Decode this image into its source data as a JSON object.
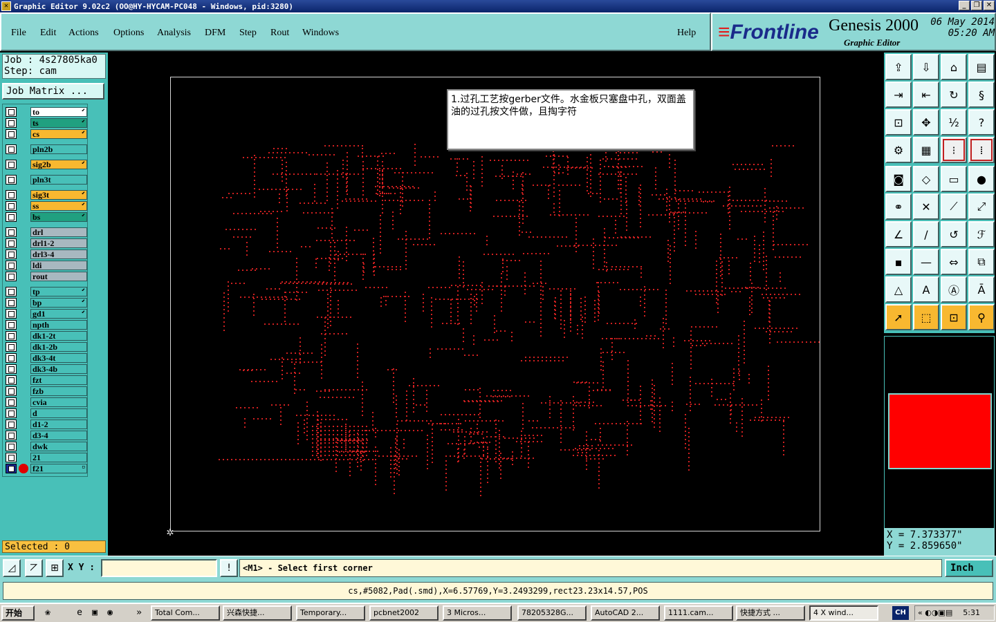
{
  "window": {
    "title": "Graphic Editor 9.02c2  (OO@HY-HYCAM-PC048 - Windows, pid:3280)",
    "controls": [
      "_",
      "❐",
      "✕"
    ]
  },
  "menu": {
    "items": [
      "File",
      "Edit",
      "Actions",
      "Options",
      "Analysis",
      "DFM",
      "Step",
      "Rout",
      "Windows"
    ],
    "help": "Help"
  },
  "brand": {
    "logo": "Frontline",
    "product": "Genesis 2000",
    "subtitle": "Graphic Editor",
    "date": "06 May 2014",
    "time": "05:20 AM"
  },
  "job": {
    "job_line": "Job : 4s27805ka0",
    "step_line": "Step: cam",
    "matrix_button": "Job Matrix ..."
  },
  "layers": [
    {
      "name": "to",
      "color": "#ffffff",
      "mark": "⬋"
    },
    {
      "name": "ts",
      "color": "#20a080",
      "mark": "⬋"
    },
    {
      "name": "cs",
      "color": "#f8b830",
      "mark": "⬋"
    },
    {
      "name": "pln2b",
      "color": "#48c0b8",
      "mark": ""
    },
    {
      "name": "sig2b",
      "color": "#f8b830",
      "mark": "⬋"
    },
    {
      "name": "pln3t",
      "color": "#48c0b8",
      "mark": ""
    },
    {
      "name": "sig3t",
      "color": "#f8b830",
      "mark": "⬋"
    },
    {
      "name": "ss",
      "color": "#f8b830",
      "mark": "⬋"
    },
    {
      "name": "bs",
      "color": "#20a080",
      "mark": "⬋"
    },
    {
      "name": "drl",
      "color": "#a8b8c0",
      "mark": ""
    },
    {
      "name": "drl1-2",
      "color": "#a8b8c0",
      "mark": ""
    },
    {
      "name": "drl3-4",
      "color": "#a8b8c0",
      "mark": ""
    },
    {
      "name": "ldi",
      "color": "#a8b8c0",
      "mark": ""
    },
    {
      "name": "rout",
      "color": "#a8b8c0",
      "mark": ""
    },
    {
      "name": "tp",
      "color": "#48c0b8",
      "mark": "⬋"
    },
    {
      "name": "bp",
      "color": "#48c0b8",
      "mark": "⬋"
    },
    {
      "name": "gd1",
      "color": "#48c0b8",
      "mark": "⬋"
    },
    {
      "name": "npth",
      "color": "#48c0b8",
      "mark": ""
    },
    {
      "name": "dk1-2t",
      "color": "#48c0b8",
      "mark": ""
    },
    {
      "name": "dk1-2b",
      "color": "#48c0b8",
      "mark": ""
    },
    {
      "name": "dk3-4t",
      "color": "#48c0b8",
      "mark": ""
    },
    {
      "name": "dk3-4b",
      "color": "#48c0b8",
      "mark": ""
    },
    {
      "name": "fzt",
      "color": "#48c0b8",
      "mark": ""
    },
    {
      "name": "fzb",
      "color": "#48c0b8",
      "mark": ""
    },
    {
      "name": "cvia",
      "color": "#48c0b8",
      "mark": ""
    },
    {
      "name": "d",
      "color": "#48c0b8",
      "mark": ""
    },
    {
      "name": "d1-2",
      "color": "#48c0b8",
      "mark": ""
    },
    {
      "name": "d3-4",
      "color": "#48c0b8",
      "mark": ""
    },
    {
      "name": "dwk",
      "color": "#48c0b8",
      "mark": ""
    },
    {
      "name": "21",
      "color": "#48c0b8",
      "mark": ""
    },
    {
      "name": "f21",
      "color": "#48c0b8",
      "mark": "▫",
      "active": true
    }
  ],
  "selected": "Selected : 0",
  "note": {
    "text": "1.过孔工艺按gerber文件。水金板只塞盘中孔，双面盖油的过孔按文件做，且掏字符"
  },
  "coords": {
    "x": "X = 7.373377\"",
    "y": "Y = 2.859650\""
  },
  "command": {
    "xy_label": "X Y :",
    "xy_value": "",
    "prompt": "<M1> - Select first corner",
    "unit": "Inch"
  },
  "status": "cs,#5082,Pad(.smd),X=6.57769,Y=3.2493299,rect23.23x14.57,POS",
  "taskbar": {
    "start": "开始",
    "tasks": [
      "Total Com...",
      "兴森快捷...",
      "Temporary...",
      "pcbnet2002",
      "3 Micros...",
      "78205328G...",
      "AutoCAD 2...",
      "1111.cam...",
      "快捷方式 ...",
      "4 X wind..."
    ],
    "lang": "CH",
    "clock": "5:31"
  },
  "colors": {
    "panel": "#48c0b8",
    "menubar": "#8ed8d4",
    "pads": "#d02020",
    "highlight": "#f8b830"
  }
}
